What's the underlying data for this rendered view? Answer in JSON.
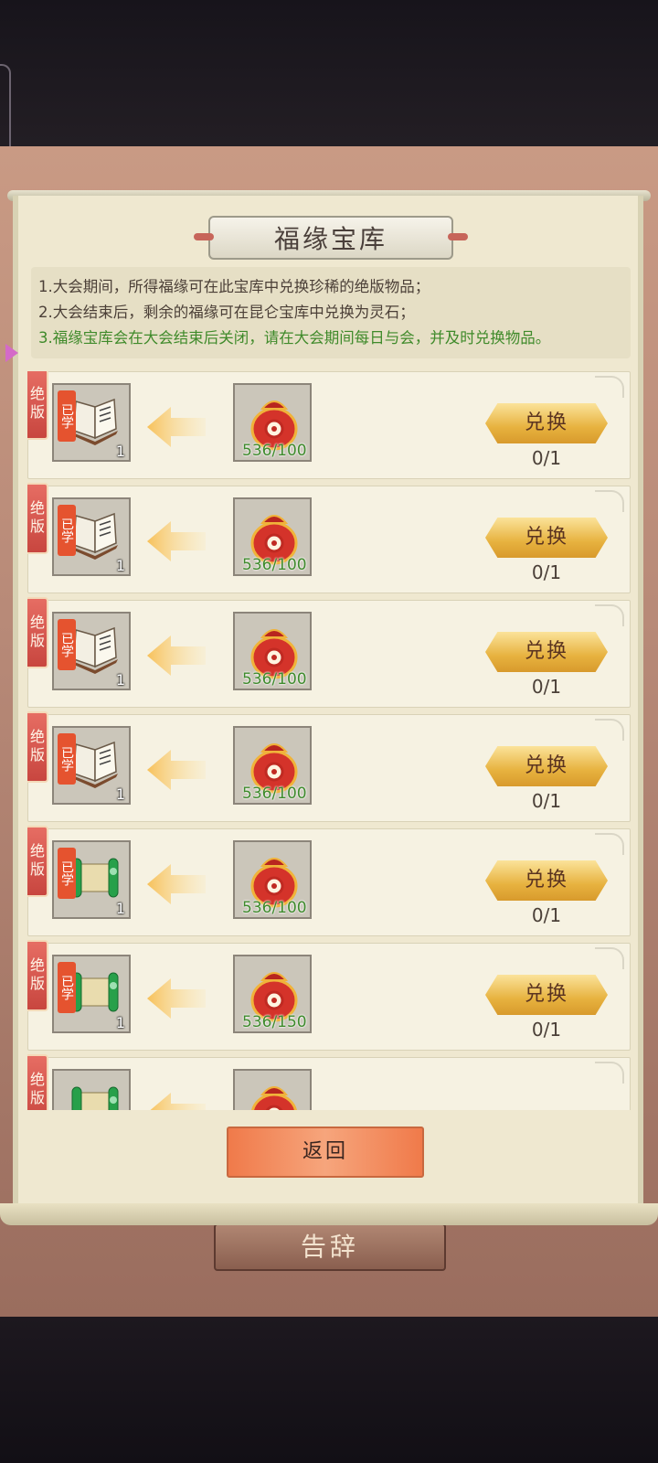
{
  "dialog": {
    "title": "福缘宝库",
    "rules": [
      "1.大会期间，所得福缘可在此宝库中兑换珍稀的绝版物品；",
      "2.大会结束后，剩余的福缘可在昆仑宝库中兑换为灵石；",
      "3.福缘宝库会在大会结束后关闭，请在大会期间每日与会，并及时兑换物品。"
    ],
    "return_label": "返回"
  },
  "background": {
    "farewell_label": "告辞"
  },
  "items": [
    {
      "tag": "绝版",
      "learned": "已学",
      "item_type": "book",
      "qty": "1",
      "cost": "536/100",
      "button": "兑换",
      "count": "0/1"
    },
    {
      "tag": "绝版",
      "learned": "已学",
      "item_type": "book",
      "qty": "1",
      "cost": "536/100",
      "button": "兑换",
      "count": "0/1"
    },
    {
      "tag": "绝版",
      "learned": "已学",
      "item_type": "book",
      "qty": "1",
      "cost": "536/100",
      "button": "兑换",
      "count": "0/1"
    },
    {
      "tag": "绝版",
      "learned": "已学",
      "item_type": "book",
      "qty": "1",
      "cost": "536/100",
      "button": "兑换",
      "count": "0/1"
    },
    {
      "tag": "绝版",
      "learned": "已学",
      "item_type": "scroll",
      "qty": "1",
      "cost": "536/100",
      "button": "兑换",
      "count": "0/1"
    },
    {
      "tag": "绝版",
      "learned": "已学",
      "item_type": "scroll",
      "qty": "1",
      "cost": "536/150",
      "button": "兑换",
      "count": "0/1"
    },
    {
      "tag": "绝版",
      "learned": "",
      "item_type": "scroll",
      "qty": "",
      "cost": "",
      "button": "",
      "count": ""
    }
  ],
  "colors": {
    "panel": "#efe8d0",
    "accent_gold": "#e7b23f",
    "rule_green": "#3f8a2a",
    "tag_red": "#c8463f"
  }
}
